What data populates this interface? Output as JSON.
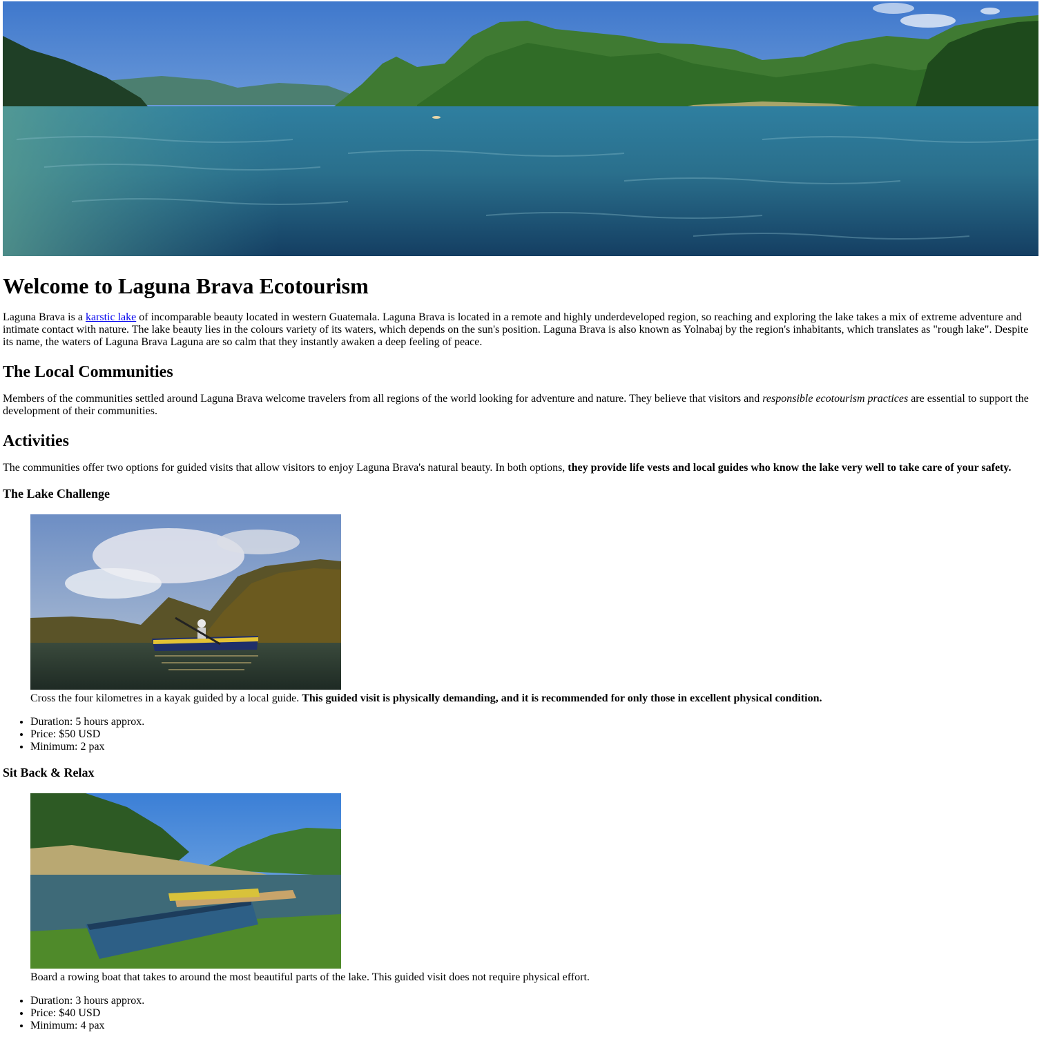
{
  "page": {
    "title": "Welcome to Laguna Brava Ecotourism",
    "intro": {
      "before_link": "Laguna Brava is a ",
      "link_text": "karstic lake",
      "after_link": " of incomparable beauty located in western Guatemala. Laguna Brava is located in a remote and highly underdeveloped region, so reaching and exploring the lake takes a mix of extreme adventure and intimate contact with nature. The lake beauty lies in the colours variety of its waters, which depends on the sun's position. Laguna Brava is also known as Yolnabaj by the region's inhabitants, which translates as \"rough lake\". Despite its name, the waters of Laguna Brava Laguna are so calm that they instantly awaken a deep feeling of peace."
    }
  },
  "communities": {
    "heading": "The Local Communities",
    "text_before": "Members of the communities settled around Laguna Brava welcome travelers from all regions of the world looking for adventure and nature. They believe that visitors and ",
    "text_emphasis": "responsible ecotourism practices",
    "text_after": " are essential to support the development of their communities."
  },
  "activities": {
    "heading": "Activities",
    "text_before": "The communities offer two options for guided visits that allow visitors to enjoy Laguna Brava's natural beauty. In both options, ",
    "text_strong": "they provide life vests and local guides who know the lake very well to take care of your safety.",
    "options": [
      {
        "heading": "The Lake Challenge",
        "caption_plain": "Cross the four kilometres in a kayak guided by a local guide. ",
        "caption_strong": "This guided visit is physically demanding, and it is recommended for only those in excellent physical condition.",
        "details": [
          "Duration: 5 hours approx.",
          "Price: $50 USD",
          "Minimum: 2 pax"
        ]
      },
      {
        "heading": "Sit Back & Relax",
        "caption_plain": "Board a rowing boat that takes to around the most beautiful parts of the lake. This guided visit does not require physical effort.",
        "caption_strong": "",
        "details": [
          "Duration: 3 hours approx.",
          "Price: $40 USD",
          "Minimum: 4 pax"
        ]
      }
    ]
  },
  "colors": {
    "link": "#0000ee",
    "text": "#000000",
    "background": "#ffffff"
  }
}
